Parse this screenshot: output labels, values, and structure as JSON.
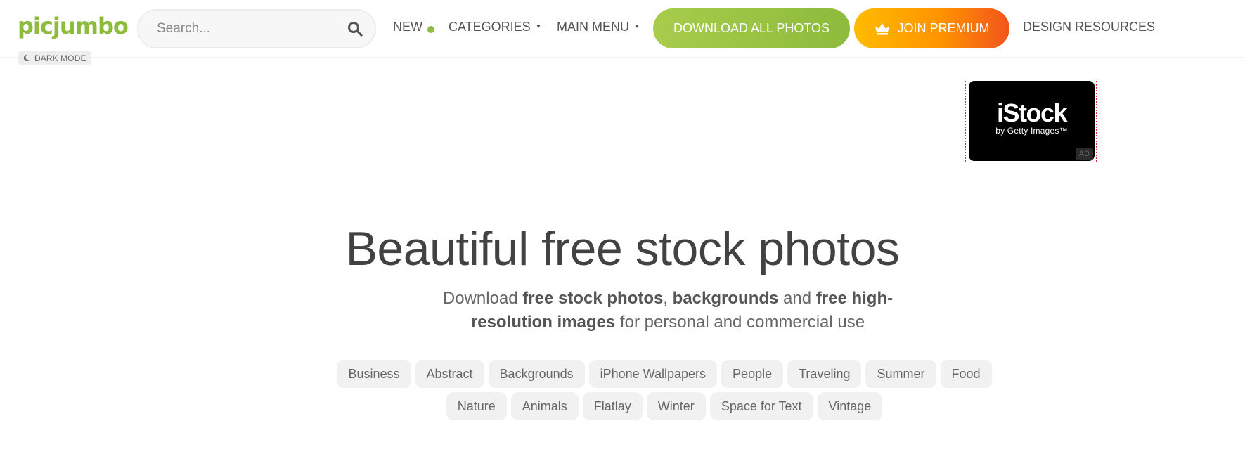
{
  "header": {
    "logo": "picjumbo",
    "search": {
      "placeholder": "Search..."
    },
    "nav": {
      "new": "NEW",
      "categories": "CATEGORIES",
      "main_menu": "MAIN MENU",
      "download_all": "DOWNLOAD ALL PHOTOS",
      "join_premium": "JOIN PREMIUM",
      "design_resources": "DESIGN RESOURCES"
    },
    "dark_mode": "DARK MODE"
  },
  "ad": {
    "brand": "iStock",
    "sub": "by Getty Images™",
    "badge": "AD"
  },
  "hero": {
    "title": "Beautiful free stock photos",
    "sub_parts": [
      "Download ",
      "free stock photos",
      ", ",
      "backgrounds",
      " and ",
      "free high-resolution images",
      " for personal and commercial use"
    ]
  },
  "tags": {
    "row1": [
      "Business",
      "Abstract",
      "Backgrounds",
      "iPhone Wallpapers",
      "People",
      "Traveling",
      "Summer",
      "Food"
    ],
    "row2": [
      "Nature",
      "Animals",
      "Flatlay",
      "Winter",
      "Space for Text",
      "Vintage"
    ]
  },
  "colors": {
    "brand_green": "#8dbb3c",
    "premium_orange": "#ff9400",
    "text": "#555555"
  },
  "icons": [
    "search-icon",
    "crown-icon",
    "moon-icon",
    "caret-down-icon"
  ]
}
